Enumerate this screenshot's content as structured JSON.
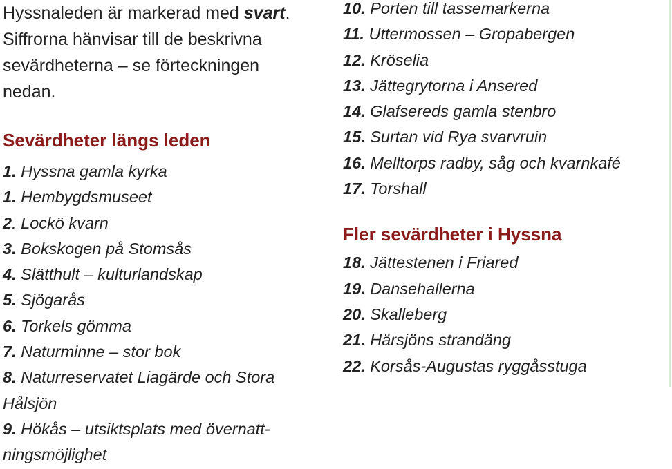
{
  "intro": {
    "line1_before": "Hyssnaleden är markerad med ",
    "line1_em": "svart",
    "line1_after": ".",
    "line2": "Siffrorna hänvisar till de beskrivna",
    "line3": "sevärdheterna – se förteckningen",
    "line4": "nedan."
  },
  "section_left": {
    "heading": "Sevärdheter längs leden",
    "items": [
      {
        "num": "1.",
        "text": " Hyssna gamla kyrka"
      },
      {
        "num": "1.",
        "text": " Hembygdsmuseet"
      },
      {
        "num": "2",
        "text": ". Lockö kvarn"
      },
      {
        "num": "3.",
        "text": " Bokskogen på Stomsås"
      },
      {
        "num": "4.",
        "text": " Slätthult – kulturlandskap"
      },
      {
        "num": "5.",
        "text": " Sjögarås"
      },
      {
        "num": "6.",
        "text": " Torkels gömma"
      },
      {
        "num": "7.",
        "text": " Naturminne – stor bok"
      },
      {
        "num": "8.",
        "text": " Naturreservatet Liagärde och Stora",
        "text2": "Hålsjön"
      },
      {
        "num": "9.",
        "text": " Hökås – utsiktsplats med övernatt-",
        "text2": "ningsmöjlighet"
      }
    ]
  },
  "section_right": {
    "items_top": [
      {
        "num": "10.",
        "text": " Porten till tassemarkerna"
      },
      {
        "num": "11.",
        "text": " Uttermossen – Gropabergen"
      },
      {
        "num": "12.",
        "text": " Kröselia"
      },
      {
        "num": "13.",
        "text": " Jättegrytorna i Ansered"
      },
      {
        "num": "14.",
        "text": " Glafsereds gamla stenbro"
      },
      {
        "num": "15.",
        "text": " Surtan vid Rya svarvruin"
      },
      {
        "num": "16.",
        "text": " Melltorps radby, såg och kvarnkafé"
      },
      {
        "num": "17.",
        "text": " Torshall"
      }
    ],
    "heading": "Fler sevärdheter i Hyssna",
    "items_bottom": [
      {
        "num": "18.",
        "text": " Jättestenen i Friared"
      },
      {
        "num": "19.",
        "text": " Dansehallerna"
      },
      {
        "num": "20.",
        "text": " Skalleberg"
      },
      {
        "num": "21.",
        "text": " Härsjöns strandäng"
      },
      {
        "num": "22.",
        "text": " Korsås-Augustas ryggåsstuga"
      }
    ]
  },
  "colors": {
    "heading": "#8b1a1a",
    "text": "#222222",
    "border": "#c8e0c4"
  }
}
